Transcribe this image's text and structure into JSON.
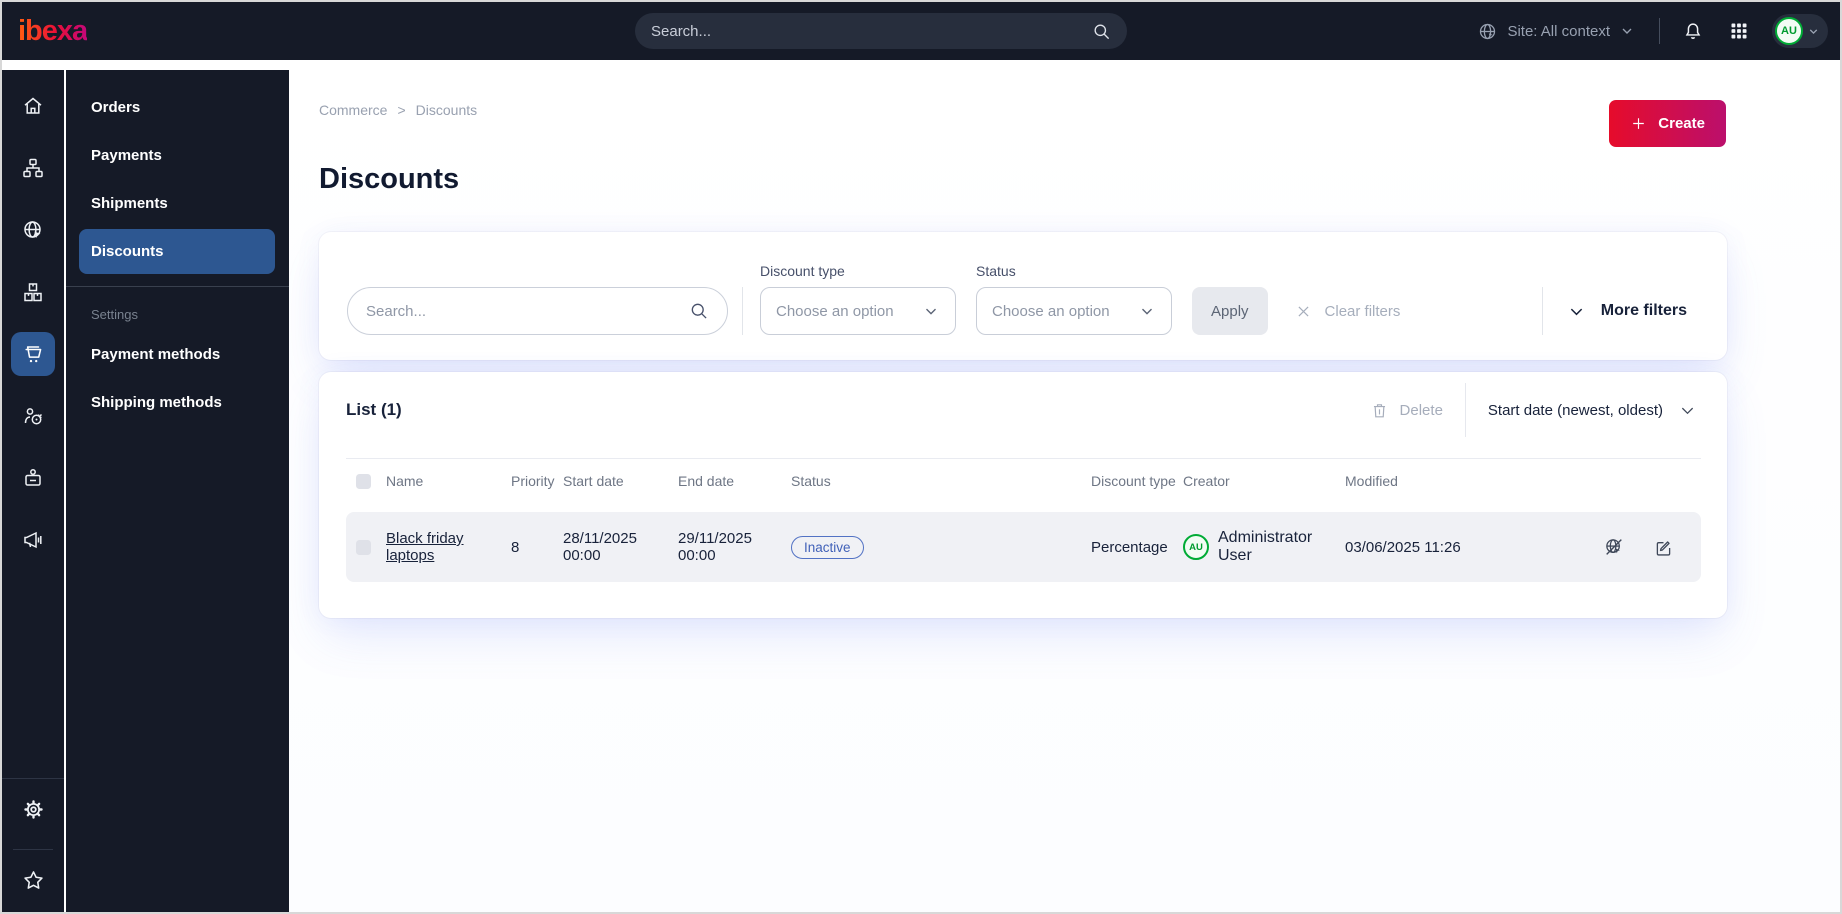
{
  "topbar": {
    "logo_text": "ibexa",
    "search_placeholder": "Search...",
    "site_context_label": "Site: All context",
    "avatar_initials": "AU",
    "icons": [
      "search-icon",
      "site-context-globe-icon",
      "notifications-bell-icon",
      "app-grid-icon",
      "chevron-down-icon"
    ]
  },
  "rail": {
    "icons": [
      "home-icon",
      "content-tree-icon",
      "site-icon",
      "product-catalog-icon",
      "commerce-cart-icon",
      "customers-icon",
      "user-badge-icon",
      "marketing-megaphone-icon",
      "settings-gear-icon",
      "favorites-star-icon"
    ],
    "active_icon": "commerce-cart-icon"
  },
  "subnav": {
    "items": [
      {
        "label": "Orders"
      },
      {
        "label": "Payments"
      },
      {
        "label": "Shipments"
      },
      {
        "label": "Discounts",
        "active": true
      }
    ],
    "section_label": "Settings",
    "section_items": [
      {
        "label": "Payment methods"
      },
      {
        "label": "Shipping methods"
      }
    ]
  },
  "breadcrumb": {
    "items": [
      "Commerce",
      "Discounts"
    ],
    "separator": ">"
  },
  "page": {
    "title": "Discounts",
    "create_button": "Create"
  },
  "filters": {
    "search_placeholder": "Search...",
    "discount_type": {
      "label": "Discount type",
      "value": "Choose an option"
    },
    "status": {
      "label": "Status",
      "value": "Choose an option"
    },
    "apply_button": "Apply",
    "clear_button": "Clear filters",
    "more_button": "More filters"
  },
  "list": {
    "title": "List (1)",
    "delete_button": "Delete",
    "sort_selector": "Start date (newest, oldest)",
    "columns": [
      "Name",
      "Priority",
      "Start date",
      "End date",
      "Status",
      "Discount type",
      "Creator",
      "Modified"
    ],
    "rows": [
      {
        "name": "Black friday laptops",
        "priority": "8",
        "start_date": "28/11/2025 00:00",
        "end_date": "29/11/2025 00:00",
        "status": "Inactive",
        "discount_type": "Percentage",
        "creator": "Administrator User",
        "creator_initials": "AU",
        "modified": "03/06/2025 11:26",
        "row_icons": [
          "site-preview-disabled-icon",
          "edit-icon"
        ]
      }
    ]
  },
  "colors": {
    "topbar_bg": "#151a27",
    "active_nav_bg": "#2d5791",
    "brand_gradient_start": "#e60c2b",
    "brand_gradient_end": "#bb0f6c",
    "status_inactive_blue": "#4161b8",
    "avatar_green": "#00ab35"
  }
}
